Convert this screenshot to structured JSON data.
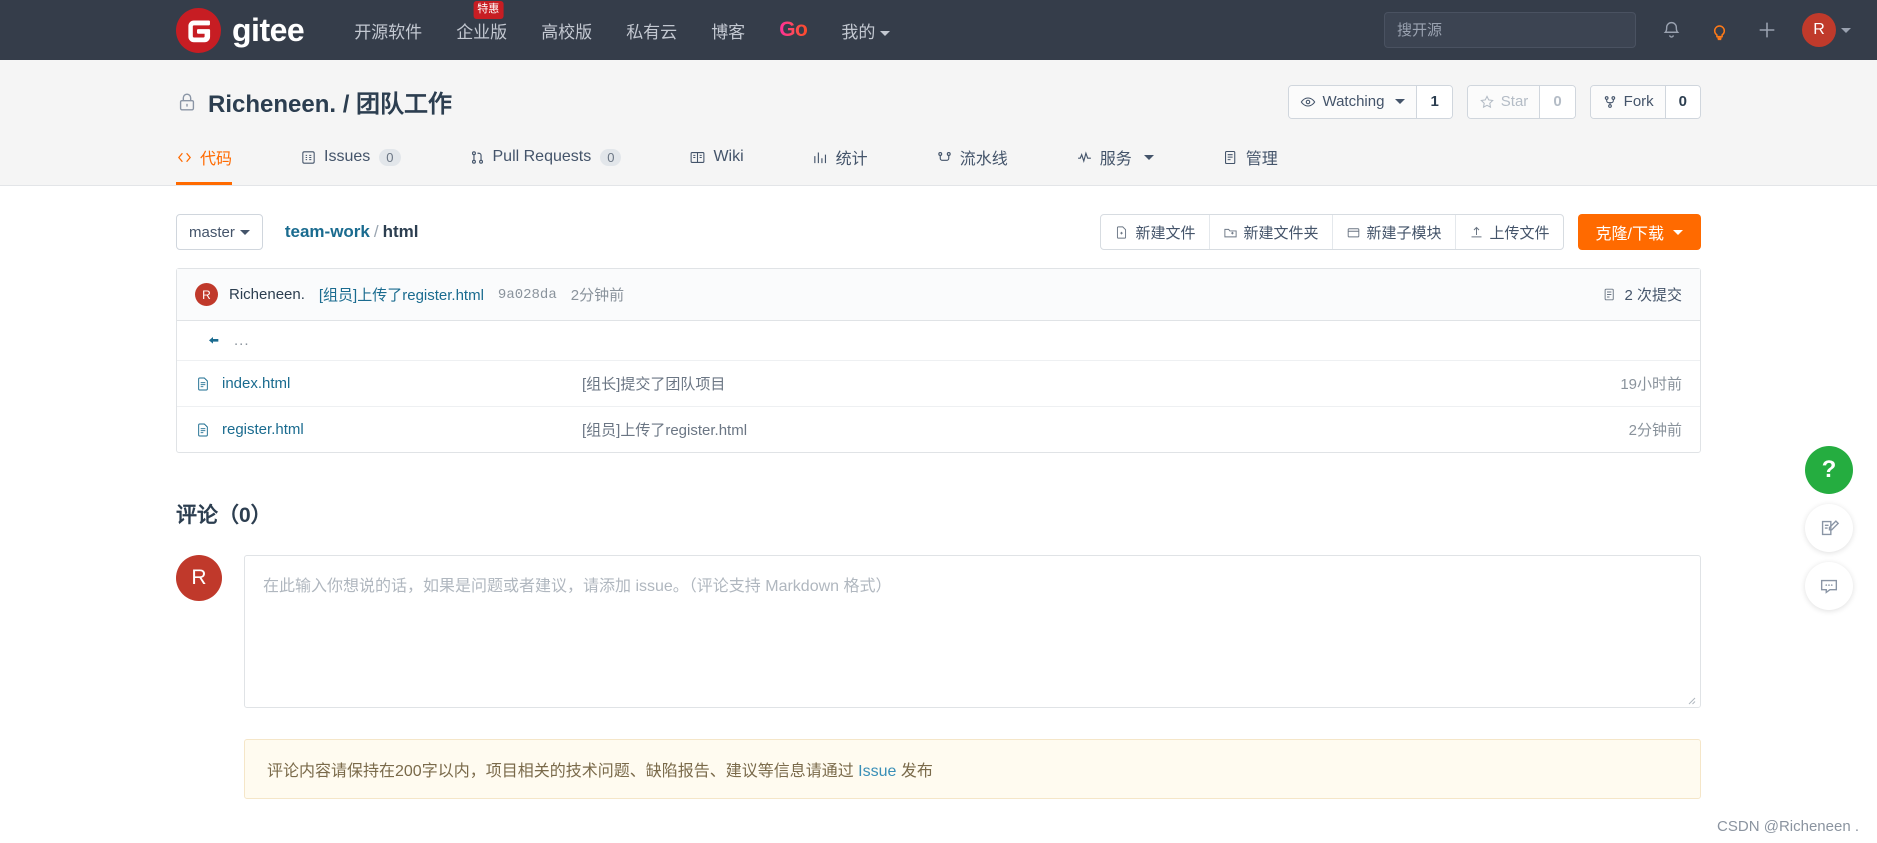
{
  "topnav": {
    "brand": "gitee",
    "brand_icon": "gitee-logo-icon",
    "links": [
      {
        "label": "开源软件",
        "badge": null
      },
      {
        "label": "企业版",
        "badge": "特惠"
      },
      {
        "label": "高校版",
        "badge": null
      },
      {
        "label": "私有云",
        "badge": null
      },
      {
        "label": "博客",
        "badge": null
      }
    ],
    "go_label": "Go",
    "mine_label": "我的",
    "search_placeholder": "搜开源",
    "search_value": "",
    "icons": [
      "bell-icon",
      "lightbulb-icon",
      "plus-icon"
    ],
    "avatar_initial": "R"
  },
  "repo": {
    "visibility_icon": "lock-icon",
    "owner": "Richeneen.",
    "separator": "/",
    "name": "团队工作",
    "full_title": "Richeneen. / 团队工作",
    "watch": {
      "label": "Watching",
      "count": "1",
      "icon": "eye-icon"
    },
    "star": {
      "label": "Star",
      "count": "0",
      "icon": "star-icon"
    },
    "fork": {
      "label": "Fork",
      "count": "0",
      "icon": "fork-icon"
    }
  },
  "tabs": [
    {
      "label": "代码",
      "icon": "code-icon",
      "count": null,
      "active": true
    },
    {
      "label": "Issues",
      "icon": "issue-icon",
      "count": "0",
      "active": false
    },
    {
      "label": "Pull Requests",
      "icon": "pull-request-icon",
      "count": "0",
      "active": false
    },
    {
      "label": "Wiki",
      "icon": "wiki-icon",
      "count": null,
      "active": false
    },
    {
      "label": "统计",
      "icon": "chart-icon",
      "count": null,
      "active": false
    },
    {
      "label": "流水线",
      "icon": "pipeline-icon",
      "count": null,
      "active": false
    },
    {
      "label": "服务",
      "icon": "service-icon",
      "count": null,
      "active": false,
      "dropdown": true
    },
    {
      "label": "管理",
      "icon": "manage-icon",
      "count": null,
      "active": false
    }
  ],
  "toolbar": {
    "branch": "master",
    "breadcrumb": {
      "root": "team-work",
      "sep": "/",
      "current": "html"
    },
    "buttons": [
      {
        "label": "新建文件",
        "icon": "new-file-icon"
      },
      {
        "label": "新建文件夹",
        "icon": "new-folder-icon"
      },
      {
        "label": "新建子模块",
        "icon": "new-submodule-icon"
      },
      {
        "label": "上传文件",
        "icon": "upload-icon"
      }
    ],
    "clone_label": "克隆/下载"
  },
  "commit": {
    "avatar_initial": "R",
    "author": "Richeneen.",
    "message": "[组员]上传了register.html",
    "sha": "9a028da",
    "time": "2分钟前",
    "count_label": "2 次提交",
    "count_icon": "commit-history-icon"
  },
  "files": {
    "up_label": "...",
    "up_icon": "arrow-back-icon",
    "rows": [
      {
        "name": "index.html",
        "icon": "file-icon",
        "message": "[组长]提交了团队项目",
        "time": "19小时前"
      },
      {
        "name": "register.html",
        "icon": "file-icon",
        "message": "[组员]上传了register.html",
        "time": "2分钟前"
      }
    ]
  },
  "comments": {
    "title": "评论（0）",
    "avatar_initial": "R",
    "placeholder": "在此输入你想说的话，如果是问题或者建议，请添加 issue。（评论支持 Markdown 格式）",
    "value": "",
    "notice_prefix": "评论内容请保持在200字以内，项目相关的技术问题、缺陷报告、建议等信息请通过 ",
    "notice_link": "Issue",
    "notice_suffix": " 发布"
  },
  "floating": {
    "help_label": "?",
    "buttons": [
      "help-icon",
      "feedback-edit-icon",
      "chat-icon"
    ]
  },
  "watermark": "CSDN @Richeneen .",
  "colors": {
    "nav_bg": "#353d4a",
    "brand_red": "#c71d23",
    "accent_orange": "#ff6a00",
    "link_teal": "#1a6b8f",
    "green": "#25ad40"
  }
}
